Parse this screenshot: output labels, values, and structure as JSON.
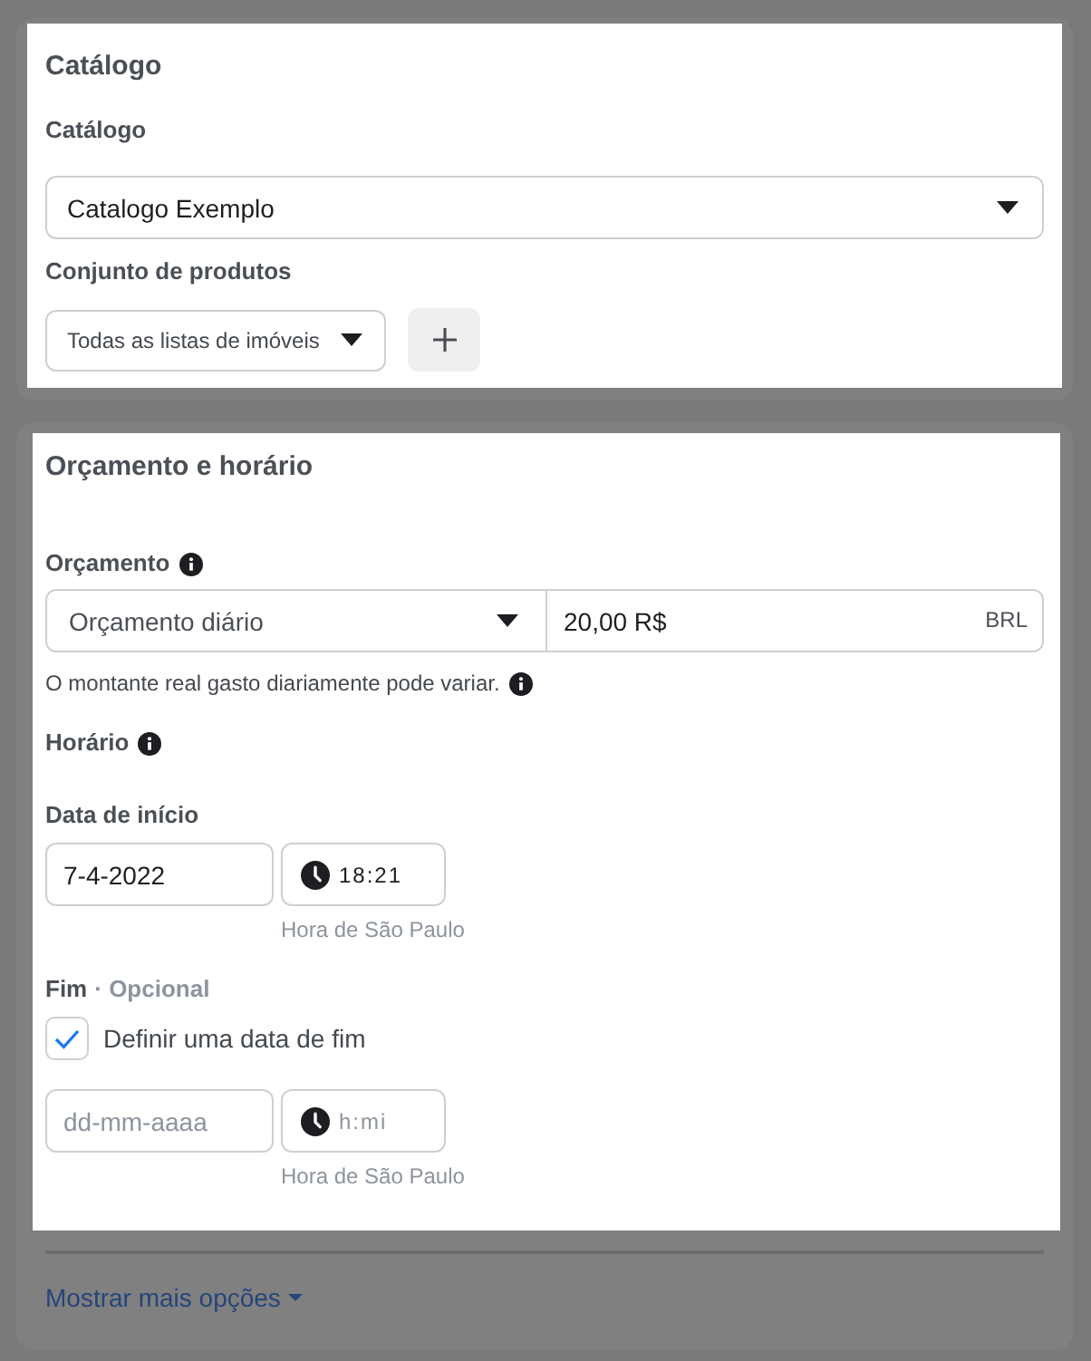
{
  "catalog": {
    "highlighted": true,
    "title": "Catálogo",
    "catalog_label": "Catálogo",
    "catalog_select": {
      "value": "Catalogo Exemplo"
    },
    "product_set_label": "Conjunto de produtos",
    "product_set_select": {
      "value": "Todas as listas de imóveis"
    }
  },
  "budget_schedule": {
    "highlighted": true,
    "title": "Orçamento e horário",
    "budget_label": "Orçamento",
    "budget_type_select": {
      "value": "Orçamento diário"
    },
    "budget_amount": {
      "value": "20,00 R$",
      "currency": "BRL"
    },
    "budget_hint": "O montante real gasto diariamente pode variar.",
    "schedule_label": "Horário",
    "start": {
      "label": "Data de início",
      "date": {
        "value": "7-4-2022"
      },
      "time": {
        "value": "18:21"
      },
      "timezone": "Hora de São Paulo"
    },
    "end": {
      "label": "Fim",
      "optional_label": "· Opcional",
      "checkbox": {
        "label": "Definir uma data de fim",
        "checked": true
      },
      "date": {
        "placeholder": "dd-mm-aaaa"
      },
      "time": {
        "placeholder": "h:mi"
      },
      "timezone": "Hora de São Paulo"
    }
  },
  "more_options_link": {
    "label": "Mostrar mais opções"
  }
}
